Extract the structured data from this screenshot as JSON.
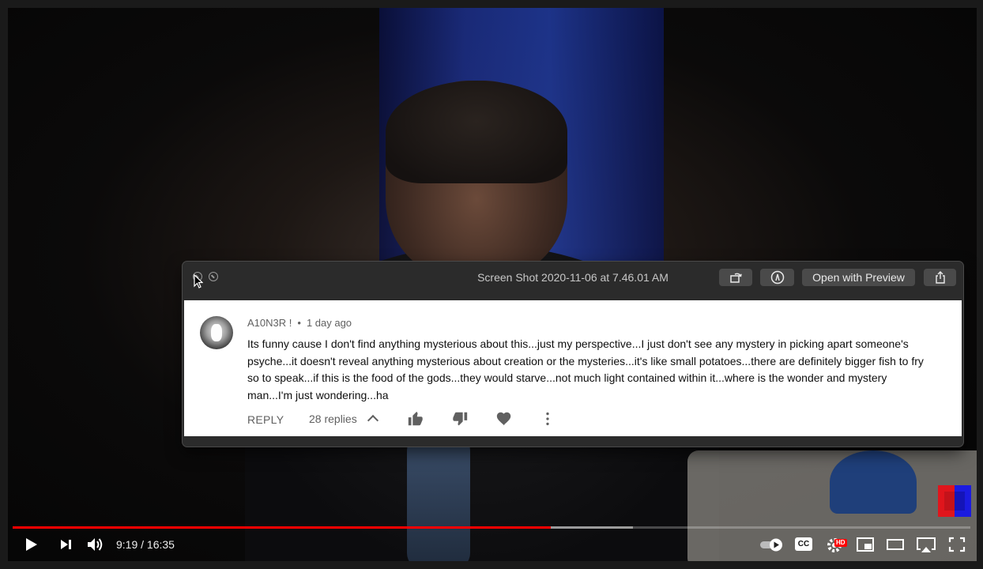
{
  "quicklook": {
    "title": "Screen Shot 2020-11-06 at 7.46.01 AM",
    "open_with_label": "Open with Preview"
  },
  "comment": {
    "author": "A10N3R !",
    "separator": "•",
    "time": "1 day ago",
    "text": "Its funny cause I don't find anything mysterious about this...just my perspective...I just don't see any mystery in picking apart someone's psyche...it doesn't reveal anything mysterious about creation or the mysteries...it's like small potatoes...there are definitely bigger fish to fry so to speak...if this is the food of the gods...they would starve...not much light contained within it...where is the wonder and mystery man...I'm just wondering...ha",
    "reply_label": "REPLY",
    "replies_label": "28 replies"
  },
  "player": {
    "time_display": "9:19 / 16:35",
    "played_fraction": 0.5621,
    "buffered_fraction": 0.648,
    "hd_badge": "HD",
    "cc_label": "CC",
    "icons": [
      "play-icon",
      "next-icon",
      "volume-icon",
      "autoplay-toggle",
      "cc-icon",
      "settings-icon",
      "miniplayer-icon",
      "theater-icon",
      "airplay-icon",
      "fullscreen-icon"
    ]
  },
  "colors": {
    "progress": "#ff0000",
    "quicklook_bg": "#2b2b2b"
  }
}
